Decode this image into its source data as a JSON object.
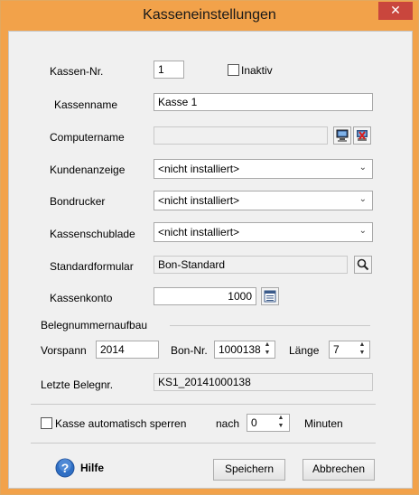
{
  "window": {
    "title": "Kasseneinstellungen",
    "close_glyph": "✕"
  },
  "fields": {
    "kassen_nr": {
      "label": "Kassen-Nr.",
      "value": "1"
    },
    "inaktiv": {
      "label": "Inaktiv",
      "checked": false
    },
    "kassenname": {
      "label": "Kassenname",
      "value": "Kasse 1"
    },
    "computername": {
      "label": "Computername",
      "value": ""
    },
    "kundenanzeige": {
      "label": "Kundenanzeige",
      "value": "<nicht installiert>"
    },
    "bondrucker": {
      "label": "Bondrucker",
      "value": "<nicht installiert>"
    },
    "kassenschublade": {
      "label": "Kassenschublade",
      "value": "<nicht installiert>"
    },
    "standardformular": {
      "label": "Standardformular",
      "value": "Bon-Standard"
    },
    "kassenkonto": {
      "label": "Kassenkonto",
      "value": "1000"
    }
  },
  "belegnummer": {
    "section_label": "Belegnummernaufbau",
    "vorspann_label": "Vorspann",
    "vorspann_value": "2014",
    "bon_nr_label": "Bon-Nr.",
    "bon_nr_value": "1000138",
    "laenge_label": "Länge",
    "laenge_value": "7",
    "letzte_label": "Letzte Belegnr.",
    "letzte_value": "KS1_20141000138"
  },
  "auto_lock": {
    "checkbox_label": "Kasse automatisch sperren",
    "checked": false,
    "nach_label": "nach",
    "value": "0",
    "unit_label": "Minuten"
  },
  "footer": {
    "help_label": "Hilfe",
    "save_label": "Speichern",
    "cancel_label": "Abbrechen"
  },
  "colors": {
    "title_bar": "#f2a24a",
    "close_button": "#c9463d",
    "help_icon": "#2f6fc4"
  }
}
